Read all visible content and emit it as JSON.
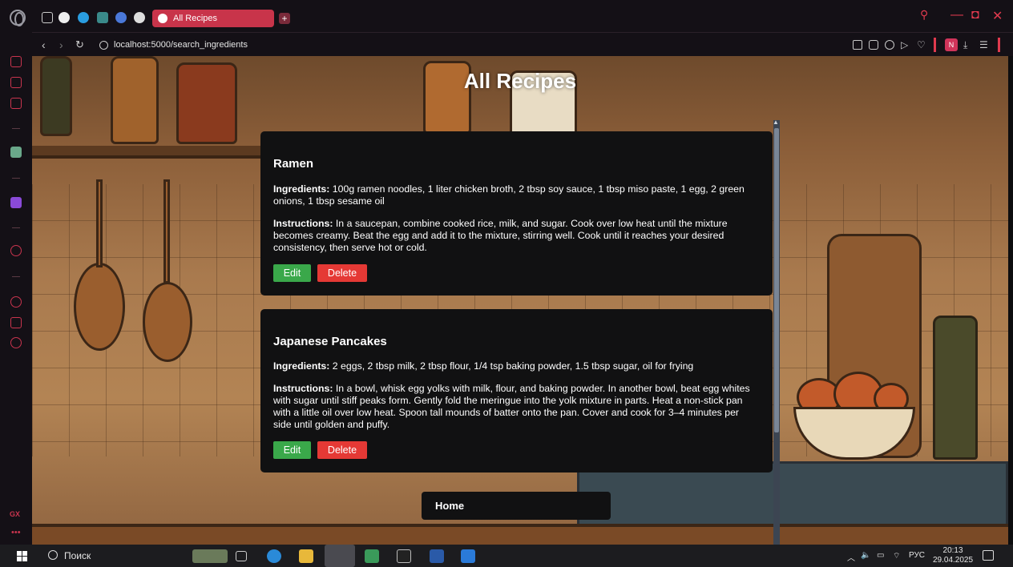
{
  "browser": {
    "tab_title": "All Recipes",
    "new_tab_label": "+",
    "url": "localhost:5000/search_ingredients",
    "profile_initial": "N",
    "sidebar_label": "GX",
    "sidebar_more": "•••",
    "accent": "#e03a4e"
  },
  "page": {
    "title": "All Recipes",
    "home_label": "Home",
    "ingredients_label": "Ingredients:",
    "instructions_label": "Instructions:",
    "edit_label": "Edit",
    "delete_label": "Delete",
    "edit_color": "#3aa84a",
    "delete_color": "#e53935"
  },
  "recipes": [
    {
      "name": "Ramen",
      "ingredients": "100g ramen noodles, 1 liter chicken broth, 2 tbsp soy sauce, 1 tbsp miso paste, 1 egg, 2 green onions, 1 tbsp sesame oil",
      "instructions": "In a saucepan, combine cooked rice, milk, and sugar. Cook over low heat until the mixture becomes creamy. Beat the egg and add it to the mixture, stirring well. Cook until it reaches your desired consistency, then serve hot or cold."
    },
    {
      "name": "Japanese Pancakes",
      "ingredients": "2 eggs, 2 tbsp milk, 2 tbsp flour, 1/4 tsp baking powder, 1.5 tbsp sugar, oil for frying",
      "instructions": "In a bowl, whisk egg yolks with milk, flour, and baking powder. In another bowl, beat egg whites with sugar until stiff peaks form. Gently fold the meringue into the yolk mixture in parts. Heat a non-stick pan with a little oil over low heat. Spoon tall mounds of batter onto the pan. Cover and cook for 3–4 minutes per side until golden and puffy."
    }
  ],
  "taskbar": {
    "search_placeholder": "Поиск",
    "language": "РУС",
    "time": "20:13",
    "date": "29.04.2025"
  }
}
